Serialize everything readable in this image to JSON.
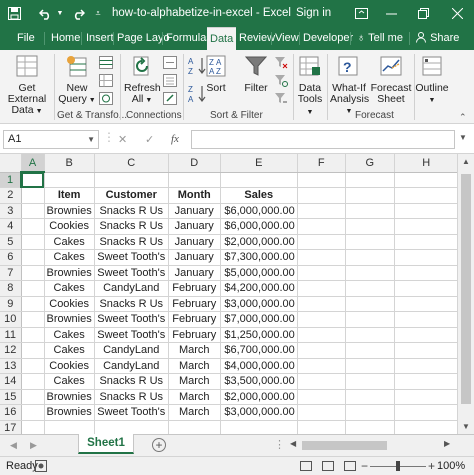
{
  "window": {
    "title": "how-to-alphabetize-in-excel - Excel",
    "sign_in": "Sign in",
    "share": "Share"
  },
  "tabs": {
    "file": "File",
    "home": "Home",
    "insert": "Insert",
    "page_layout": "Page Layo",
    "formulas": "Formulas",
    "data": "Data",
    "review": "Review",
    "view": "View",
    "developer": "Developer",
    "tell_me": "Tell me"
  },
  "ribbon": {
    "get_external_data": [
      "Get External",
      "Data"
    ],
    "new_query": [
      "New",
      "Query"
    ],
    "refresh_all": [
      "Refresh",
      "All"
    ],
    "sort": "Sort",
    "filter": "Filter",
    "data_tools": [
      "Data",
      "Tools"
    ],
    "what_if": [
      "What-If",
      "Analysis"
    ],
    "forecast_sheet": [
      "Forecast",
      "Sheet"
    ],
    "outline": "Outline",
    "groups": {
      "get_transform": "Get & Transfo...",
      "connections": "Connections",
      "sort_filter": "Sort & Filter",
      "forecast": "Forecast"
    }
  },
  "formula_bar": {
    "name_box": "A1",
    "fx": "fx",
    "value": ""
  },
  "sheet": {
    "columns": [
      "A",
      "B",
      "C",
      "D",
      "E",
      "F",
      "G",
      "H"
    ],
    "rows": [
      [
        "",
        "",
        "",
        "",
        "",
        "",
        "",
        ""
      ],
      [
        "",
        "Item",
        "Customer",
        "Month",
        "Sales",
        "",
        "",
        ""
      ],
      [
        "",
        "Brownies",
        "Snacks R Us",
        "January",
        "$6,000,000.00",
        "",
        "",
        ""
      ],
      [
        "",
        "Cookies",
        "Snacks R Us",
        "January",
        "$6,000,000.00",
        "",
        "",
        ""
      ],
      [
        "",
        "Cakes",
        "Snacks R Us",
        "January",
        "$2,000,000.00",
        "",
        "",
        ""
      ],
      [
        "",
        "Cakes",
        "Sweet Tooth's",
        "January",
        "$7,300,000.00",
        "",
        "",
        ""
      ],
      [
        "",
        "Brownies",
        "Sweet Tooth's",
        "January",
        "$5,000,000.00",
        "",
        "",
        ""
      ],
      [
        "",
        "Cakes",
        "CandyLand",
        "February",
        "$4,200,000.00",
        "",
        "",
        ""
      ],
      [
        "",
        "Cookies",
        "Snacks R Us",
        "February",
        "$3,000,000.00",
        "",
        "",
        ""
      ],
      [
        "",
        "Brownies",
        "Sweet Tooth's",
        "February",
        "$7,000,000.00",
        "",
        "",
        ""
      ],
      [
        "",
        "Cakes",
        "Sweet Tooth's",
        "February",
        "$1,250,000.00",
        "",
        "",
        ""
      ],
      [
        "",
        "Cakes",
        "CandyLand",
        "March",
        "$6,700,000.00",
        "",
        "",
        ""
      ],
      [
        "",
        "Cookies",
        "CandyLand",
        "March",
        "$4,000,000.00",
        "",
        "",
        ""
      ],
      [
        "",
        "Cakes",
        "Snacks R Us",
        "March",
        "$3,500,000.00",
        "",
        "",
        ""
      ],
      [
        "",
        "Brownies",
        "Snacks R Us",
        "March",
        "$2,000,000.00",
        "",
        "",
        ""
      ],
      [
        "",
        "Brownies",
        "Sweet Tooth's",
        "March",
        "$3,000,000.00",
        "",
        "",
        ""
      ],
      [
        "",
        "",
        "",
        "",
        "",
        "",
        "",
        ""
      ]
    ]
  },
  "sheet_tabs": {
    "active": "Sheet1"
  },
  "status": {
    "ready": "Ready",
    "zoom": "100%"
  },
  "colors": {
    "excel_green": "#217346",
    "ribbon_bg": "#f3f3f3",
    "grid_line": "#d4d4d4"
  }
}
